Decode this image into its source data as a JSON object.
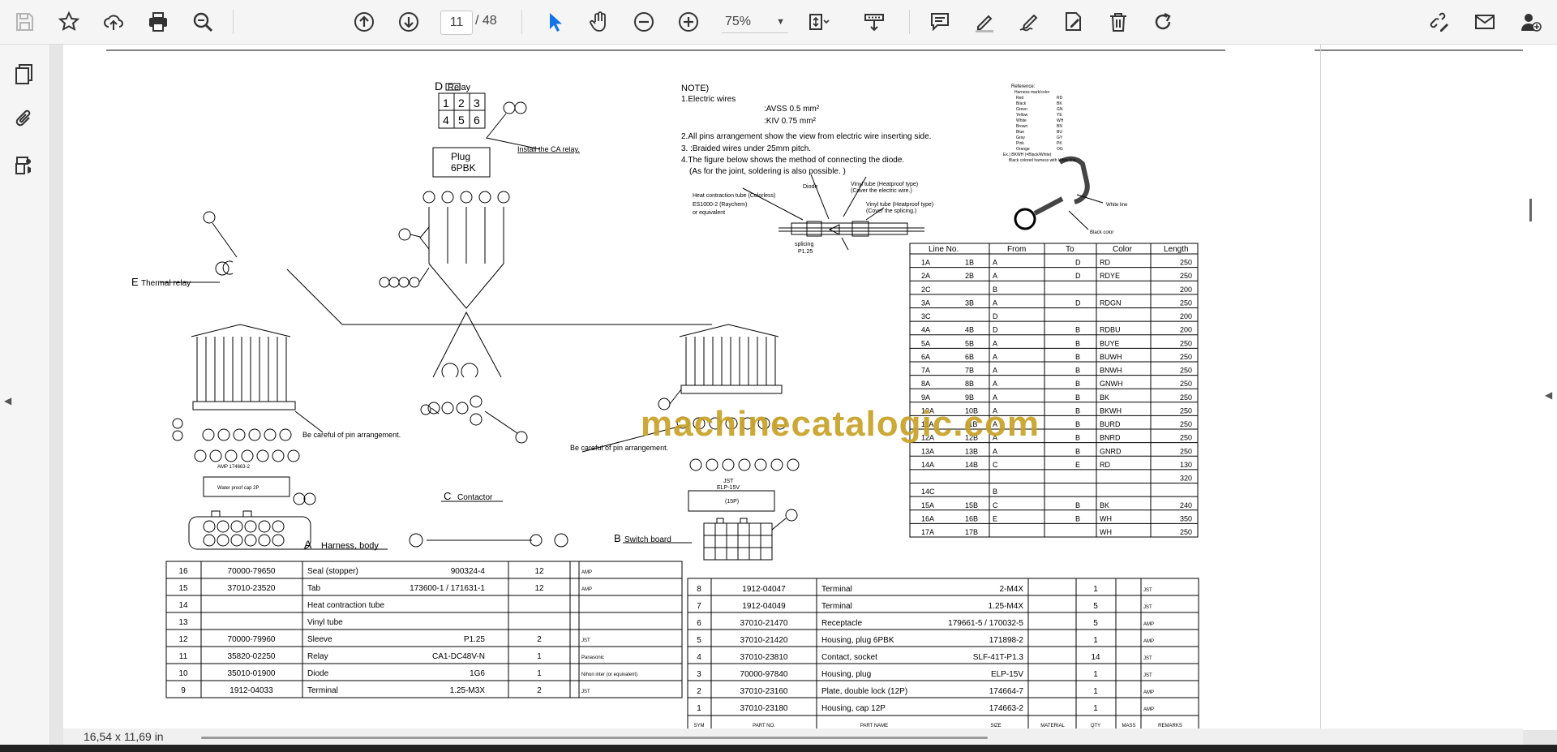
{
  "toolbar": {
    "current_page": "11",
    "total_pages": "/ 48",
    "zoom": "75%",
    "icons": [
      "save-icon",
      "bookmark-star-icon",
      "upload-cloud-icon",
      "print-icon",
      "zoom-search-icon",
      "page-up-icon",
      "page-down-icon",
      "select-cursor-icon",
      "hand-pan-icon",
      "zoom-out-icon",
      "zoom-in-icon",
      "fit-page-icon",
      "scroll-mode-icon",
      "comment-icon",
      "highlight-pen-icon",
      "sign-pen-icon",
      "edit-icon",
      "delete-trash-icon",
      "rotate-icon",
      "link-edit-icon",
      "email-icon",
      "add-user-icon"
    ]
  },
  "sidebar": {
    "icons": [
      "pages-thumbnail-icon",
      "attachment-paperclip-icon",
      "layers-icon"
    ]
  },
  "status": {
    "page_size": "16,54 x 11,69 in"
  },
  "watermark": "machinecatalogic.com",
  "drawing": {
    "notes": {
      "title": "NOTE)",
      "n1": "1.Electric wires",
      "avss": ":AVSS 0.5 mm²",
      "kiv": ":KIV 0.75 mm²",
      "n2": "2.All pins arrangement show the view from electric wire inserting side.",
      "n3": "3.       :Braided wires under 25mm pitch.",
      "n4": "4.The figure below shows the method of connecting the diode.",
      "n4b": "(As for the joint, soldering is also possible. )"
    },
    "diode_fig": {
      "diode": "Diode",
      "vinyl1": "Vinyl tube (Heatproof type)",
      "vinyl1b": "(Cover the electric wire.)",
      "heat": "Heat contraction tube (Colorless)",
      "es": "ES1000-2 (Raychem)",
      "eq": "or equivalent",
      "vinyl2": "Vinyl tube (Heatproof type)",
      "vinyl2b": "(Cover the splicing.)",
      "splicing": "splicing",
      "p125": "P1.25"
    },
    "relay": {
      "label": "D",
      "name": "Relay",
      "plug": "Plug",
      "plug2": "6PBK",
      "install": "Install the CA relay.",
      "pins": [
        "1",
        "2",
        "3",
        "4",
        "5",
        "6"
      ]
    },
    "labels": {
      "thermal_letter": "E",
      "thermal": "Thermal relay",
      "harness_letter": "A",
      "harness": "Harness, body",
      "contactor_letter": "C",
      "contactor": "Contactor",
      "switch_letter": "B",
      "switch": "Switch board",
      "careful1": "Be careful of pin arrangement.",
      "careful2": "Be careful of pin arrangement.",
      "amp": "AMP 174663-2",
      "waterproof": "Water proof cap 2P",
      "jst": "JST",
      "elp": "ELP-15V",
      "p15": "(15P)"
    },
    "wire_table": {
      "headers": [
        "Line No.",
        "From",
        "To",
        "Color",
        "Length"
      ],
      "rows": [
        [
          "1A",
          "1B",
          "A",
          "D",
          "RD",
          "250"
        ],
        [
          "2A",
          "2B",
          "A",
          "D",
          "RDYE",
          "250"
        ],
        [
          "2C",
          "",
          "B",
          "",
          "",
          "200"
        ],
        [
          "3A",
          "3B",
          "A",
          "D",
          "RDGN",
          "250"
        ],
        [
          "3C",
          "",
          "D",
          "",
          "",
          "200"
        ],
        [
          "4A",
          "4B",
          "D",
          "B",
          "RDBU",
          "200"
        ],
        [
          "5A",
          "5B",
          "A",
          "B",
          "BUYE",
          "250"
        ],
        [
          "6A",
          "6B",
          "A",
          "B",
          "BUWH",
          "250"
        ],
        [
          "7A",
          "7B",
          "A",
          "B",
          "BNWH",
          "250"
        ],
        [
          "8A",
          "8B",
          "A",
          "B",
          "GNWH",
          "250"
        ],
        [
          "9A",
          "9B",
          "A",
          "B",
          "BK",
          "250"
        ],
        [
          "10A",
          "10B",
          "A",
          "B",
          "BKWH",
          "250"
        ],
        [
          "11A",
          "11B",
          "A",
          "B",
          "BURD",
          "250"
        ],
        [
          "12A",
          "12B",
          "A",
          "B",
          "BNRD",
          "250"
        ],
        [
          "13A",
          "13B",
          "A",
          "B",
          "GNRD",
          "250"
        ],
        [
          "14A",
          "14B",
          "C",
          "E",
          "RD",
          "130"
        ],
        [
          "",
          "",
          "",
          "",
          "",
          "320"
        ],
        [
          "14C",
          "",
          "B",
          "",
          "",
          ""
        ],
        [
          "15A",
          "15B",
          "C",
          "B",
          "BK",
          "240"
        ],
        [
          "16A",
          "16B",
          "E",
          "B",
          "WH",
          "350"
        ],
        [
          "17A",
          "17B",
          "",
          "",
          "WH",
          "250"
        ]
      ]
    },
    "parts_left": [
      [
        "16",
        "70000-79650",
        "Seal (stopper)",
        "900324-4",
        "12",
        "AMP"
      ],
      [
        "15",
        "37010-23520",
        "Tab",
        "173600-1 / 171631-1",
        "12",
        "AMP"
      ],
      [
        "14",
        "",
        "Heat contraction tube",
        "",
        "",
        ""
      ],
      [
        "13",
        "",
        "Vinyl tube",
        "",
        "",
        ""
      ],
      [
        "12",
        "70000-79960",
        "Sleeve",
        "P1.25",
        "2",
        "JST"
      ],
      [
        "11",
        "35820-02250",
        "Relay",
        "CA1-DC48V-N",
        "1",
        "Panasonic"
      ],
      [
        "10",
        "35010-01900",
        "Diode",
        "1G6",
        "1",
        "Nihon inter (or equivalent)"
      ],
      [
        "9",
        "1912-04033",
        "Terminal",
        "1.25-M3X",
        "2",
        "JST"
      ]
    ],
    "parts_right": [
      [
        "8",
        "1912-04047",
        "Terminal",
        "2-M4X",
        "1",
        "JST"
      ],
      [
        "7",
        "1912-04049",
        "Terminal",
        "1.25-M4X",
        "5",
        "JST"
      ],
      [
        "6",
        "37010-21470",
        "Receptacle",
        "179661-5 / 170032-5",
        "5",
        "AMP"
      ],
      [
        "5",
        "37010-21420",
        "Housing, plug 6PBK",
        "171898-2",
        "1",
        "AMP"
      ],
      [
        "4",
        "37010-23810",
        "Contact, socket",
        "SLF-41T-P1.3",
        "14",
        "JST"
      ],
      [
        "3",
        "70000-97840",
        "Housing, plug",
        "ELP-15V",
        "1",
        "JST"
      ],
      [
        "2",
        "37010-23160",
        "Plate, double lock (12P)",
        "174664-7",
        "1",
        "AMP"
      ],
      [
        "1",
        "37010-23180",
        "Housing, cap 12P",
        "174663-2",
        "1",
        "AMP"
      ]
    ],
    "parts_footer": [
      "SYM",
      "PART NO.",
      "PART NAME",
      "SIZE",
      "MATERIAL",
      "QTY",
      "MASS",
      "REMARKS"
    ],
    "reference": {
      "title": "Reference:",
      "sub": "Harness mark/color",
      "pairs": [
        "Red RD",
        "Black BK",
        "Green GN",
        "Yellow YE",
        "White WH",
        "Brown BN",
        "Blue BU",
        "Gray GY",
        "Pink PK",
        "Orange OG"
      ],
      "ex": "Ex.) BKWH (=Black/White)",
      "ex2": "Black colored harness with White line.",
      "white_line": "White line",
      "black_color": "Black color"
    }
  }
}
